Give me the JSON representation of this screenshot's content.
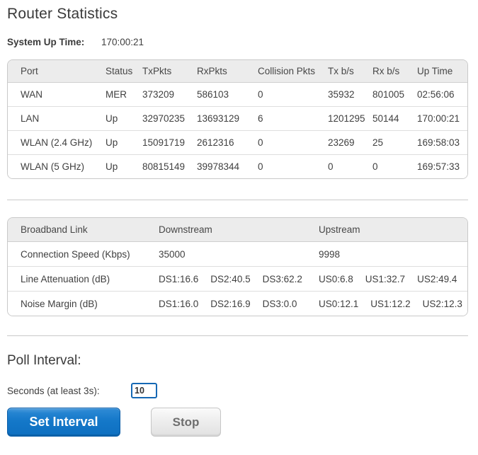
{
  "page": {
    "title": "Router Statistics"
  },
  "system_up_time": {
    "label": "System Up Time:",
    "value": "170:00:21"
  },
  "port_table": {
    "headers": [
      "Port",
      "Status",
      "TxPkts",
      "RxPkts",
      "Collision Pkts",
      "Tx b/s",
      "Rx b/s",
      "Up Time"
    ],
    "rows": [
      [
        "WAN",
        "MER",
        "373209",
        "586103",
        "0",
        "35932",
        "801005",
        "02:56:06"
      ],
      [
        "LAN",
        "Up",
        "32970235",
        "13693129",
        "6",
        "1201295",
        "50144",
        "170:00:21"
      ],
      [
        "WLAN (2.4 GHz)",
        "Up",
        "15091719",
        "2612316",
        "0",
        "23269",
        "25",
        "169:58:03"
      ],
      [
        "WLAN (5 GHz)",
        "Up",
        "80815149",
        "39978344",
        "0",
        "0",
        "0",
        "169:57:33"
      ]
    ]
  },
  "broadband_table": {
    "headers": [
      "Broadband Link",
      "Downstream",
      "Upstream"
    ],
    "rows": [
      {
        "label": "Connection Speed (Kbps)",
        "downstream": [
          "35000"
        ],
        "upstream": [
          "9998"
        ]
      },
      {
        "label": "Line Attenuation (dB)",
        "downstream": [
          "DS1:16.6",
          "DS2:40.5",
          "DS3:62.2"
        ],
        "upstream": [
          "US0:6.8",
          "US1:32.7",
          "US2:49.4"
        ]
      },
      {
        "label": "Noise Margin (dB)",
        "downstream": [
          "DS1:16.0",
          "DS2:16.9",
          "DS3:0.0"
        ],
        "upstream": [
          "US0:12.1",
          "US1:12.2",
          "US2:12.3"
        ]
      }
    ]
  },
  "poll_interval": {
    "heading": "Poll Interval:",
    "seconds_label": "Seconds (at least 3s):",
    "seconds_value": "10",
    "set_button": "Set Interval",
    "stop_button": "Stop"
  },
  "colors": {
    "accent": "#0e6fc0",
    "input_border": "#1568b4",
    "table_header_bg": "#ececec",
    "table_border": "#c9c9c9",
    "text": "#3f3f3f"
  }
}
